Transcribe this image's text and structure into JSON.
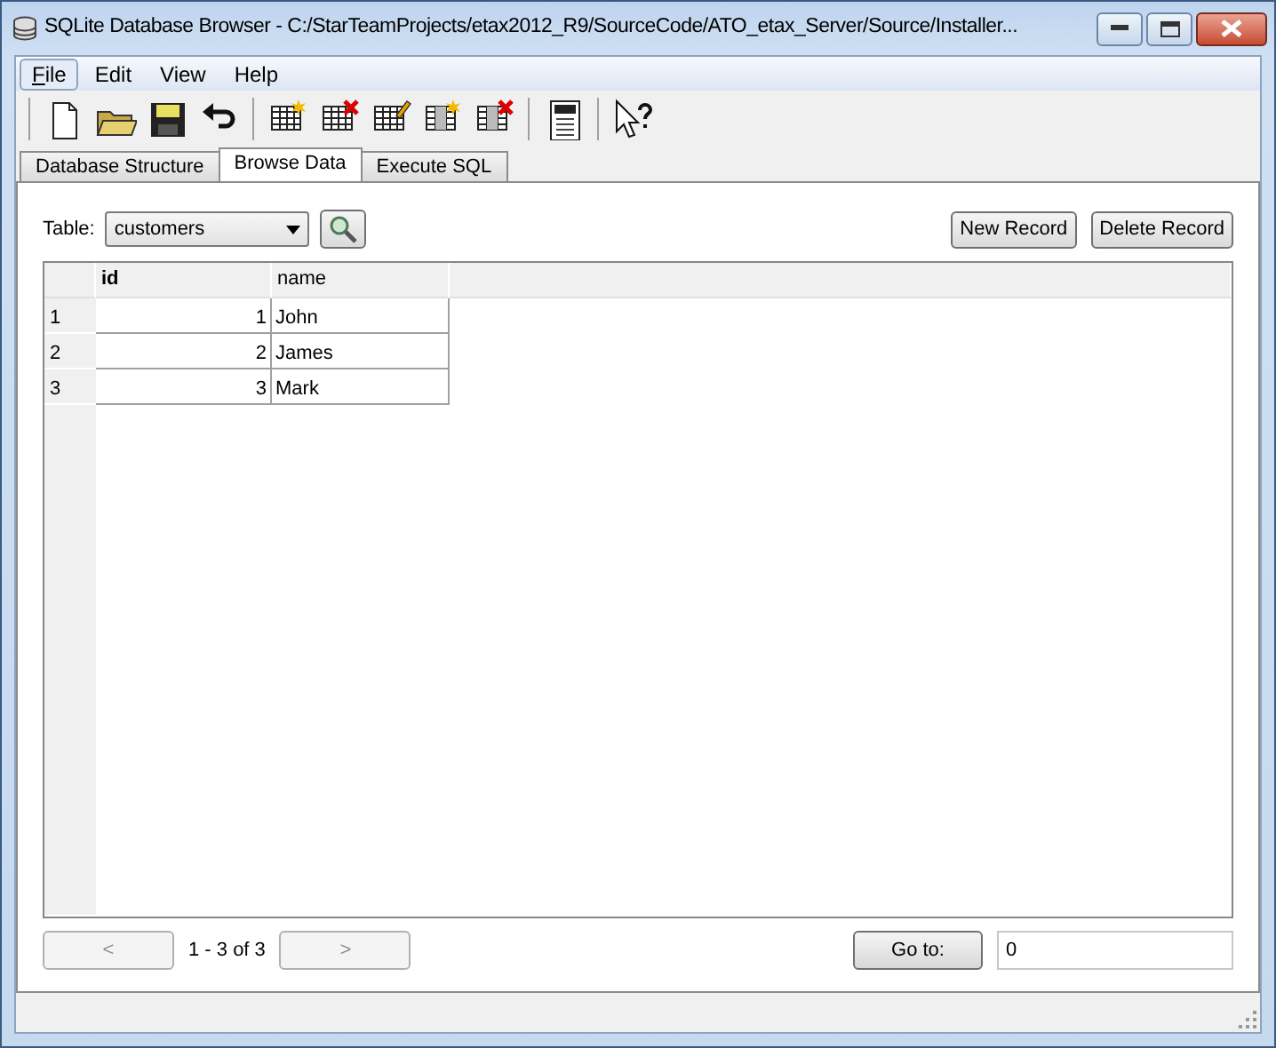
{
  "window": {
    "title": "SQLite Database Browser - C:/StarTeamProjects/etax2012_R9/SourceCode/ATO_etax_Server/Source/Installer..."
  },
  "menu": [
    {
      "label": "File",
      "highlighted": true
    },
    {
      "label": "Edit",
      "highlighted": false
    },
    {
      "label": "View",
      "highlighted": false
    },
    {
      "label": "Help",
      "highlighted": false
    }
  ],
  "tabs": [
    {
      "label": "Database Structure",
      "selected": false
    },
    {
      "label": "Browse Data",
      "selected": true
    },
    {
      "label": "Execute SQL",
      "selected": false
    }
  ],
  "table_picker": {
    "label": "Table:",
    "value": "customers"
  },
  "buttons": [
    "New Record",
    "Delete Record"
  ],
  "grid": {
    "columns": [
      {
        "label": "id",
        "selected": true
      },
      {
        "label": "name",
        "selected": false
      }
    ],
    "rows": [
      {
        "row_header": "1",
        "cells": [
          "1",
          "John"
        ]
      },
      {
        "row_header": "2",
        "cells": [
          "2",
          "James"
        ]
      },
      {
        "row_header": "3",
        "cells": [
          "3",
          "Mark"
        ]
      }
    ]
  },
  "pager": {
    "previous": {
      "label": "<",
      "disabled": true
    },
    "range": "1 - 3 of 3",
    "next": {
      "label": ">",
      "disabled": true
    },
    "goto_button": "Go to:",
    "goto_value": "0"
  }
}
